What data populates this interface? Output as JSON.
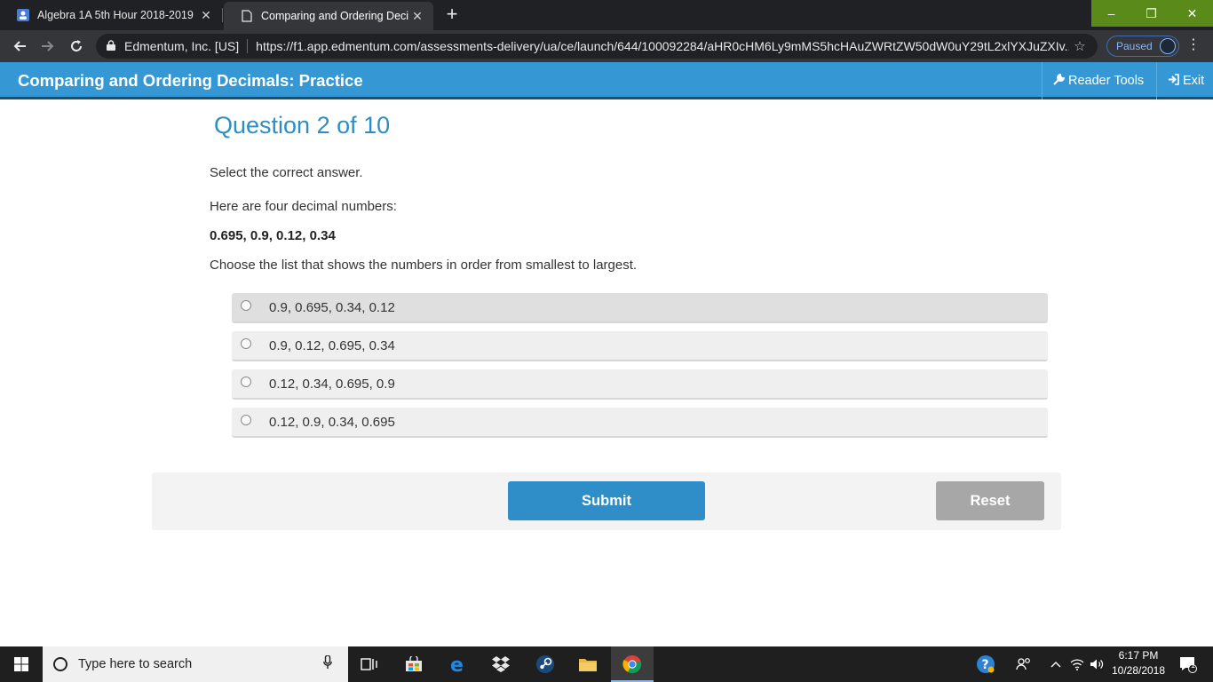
{
  "browser": {
    "tabs": [
      {
        "title": "Algebra 1A 5th Hour 2018-2019",
        "active": false,
        "icon": "classroom-icon"
      },
      {
        "title": "Comparing and Ordering Decima",
        "active": true,
        "icon": "document-icon"
      }
    ],
    "new_tab": "+",
    "window_controls": {
      "minimize": "–",
      "maximize": "❐",
      "close": "✕"
    },
    "address": {
      "org": "Edmentum, Inc. [US]",
      "url": "https://f1.app.edmentum.com/assessments-delivery/ua/ce/launch/644/100092284/aHR0cHM6Ly9mMS5hcHAuZWRtZW50dW0uY29tL2xlYXJuZXIv..."
    },
    "profile_status": "Paused"
  },
  "app": {
    "title": "Comparing and Ordering Decimals: Practice",
    "reader_tools": "Reader Tools",
    "exit": "Exit"
  },
  "question": {
    "heading": "Question 2 of 10",
    "instruction": "Select the correct answer.",
    "intro": "Here are four decimal numbers:",
    "numbers": "0.695, 0.9, 0.12, 0.34",
    "prompt": "Choose the list that shows the numbers in order from smallest to largest.",
    "options": [
      "0.9, 0.695, 0.34, 0.12",
      "0.9, 0.12, 0.695, 0.34",
      "0.12, 0.34, 0.695, 0.9",
      "0.12, 0.9, 0.34, 0.695"
    ]
  },
  "actions": {
    "submit": "Submit",
    "reset": "Reset"
  },
  "taskbar": {
    "search_placeholder": "Type here to search",
    "time": "6:17 PM",
    "date": "10/28/2018",
    "notification_count": "1"
  },
  "colors": {
    "header": "#3598d4",
    "heading": "#2e8ec4",
    "submit": "#2f8ec7",
    "reset": "#a7a7a7",
    "window_controls": "#5a8a1a"
  }
}
